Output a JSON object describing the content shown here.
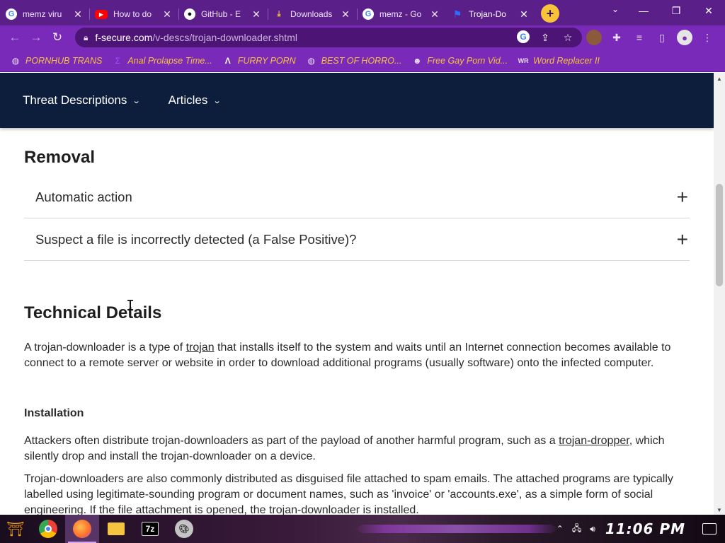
{
  "browser": {
    "tabs": [
      {
        "label": "memz viru",
        "icon": "google-icon"
      },
      {
        "label": "How to do",
        "icon": "youtube-icon"
      },
      {
        "label": "GitHub - E",
        "icon": "github-icon"
      },
      {
        "label": "Downloads",
        "icon": "download-icon"
      },
      {
        "label": "memz - Go",
        "icon": "google-icon"
      },
      {
        "label": "Trojan-Do",
        "icon": "fsecure-icon",
        "active": true
      }
    ],
    "new_tab": "+",
    "url_host": "f-secure.com",
    "url_path": "/v-descs/trojan-downloader.shtml",
    "bookmarks": [
      {
        "label": "PORNHUB TRANS",
        "icon": "globe-icon"
      },
      {
        "label": "Anal Prolapse Time...",
        "icon": "sigma-icon"
      },
      {
        "label": "FURRY PORN",
        "icon": "lambda-icon"
      },
      {
        "label": "BEST OF HORRO...",
        "icon": "globe-icon"
      },
      {
        "label": "Free Gay Porn Vid...",
        "icon": "raccoon-icon"
      },
      {
        "label": "Word Replacer II",
        "icon": "wr-icon"
      }
    ]
  },
  "site": {
    "nav": [
      "Threat Descriptions",
      "Articles"
    ]
  },
  "content": {
    "removal_heading": "Removal",
    "accordion": [
      "Automatic action",
      "Suspect a file is incorrectly detected (a False Positive)?"
    ],
    "tech_heading": "Technical Details",
    "tech_para_before": "A trojan-downloader is a type of ",
    "tech_para_link": "trojan",
    "tech_para_after": " that installs itself to the system and waits until an Internet connection becomes available to connect to a remote server or website in order to download additional programs (usually software) onto the infected computer.",
    "install_heading": "Installation",
    "install_p1_before": "Attackers often distribute trojan-downloaders as part of the payload of another harmful program, such as a ",
    "install_p1_link": "trojan-dropper",
    "install_p1_after": ", which silently drop and install the trojan-downloader on a device.",
    "install_p2": "Trojan-downloaders are also commonly distributed as disguised file attached to spam emails. The attached programs are typically labelled using legitimate-sounding program or document names, such as 'invoice' or 'accounts.exe', as a simple form of social engineering. If the file attachment is opened, the trojan-downloader is installed."
  },
  "taskbar": {
    "apps": [
      "start-icon",
      "chrome-icon",
      "firefox-icon",
      "file-explorer-icon",
      "7zip-icon",
      "paint-icon"
    ],
    "sevenzip_label": "7z",
    "clock": "11:06 PM"
  }
}
